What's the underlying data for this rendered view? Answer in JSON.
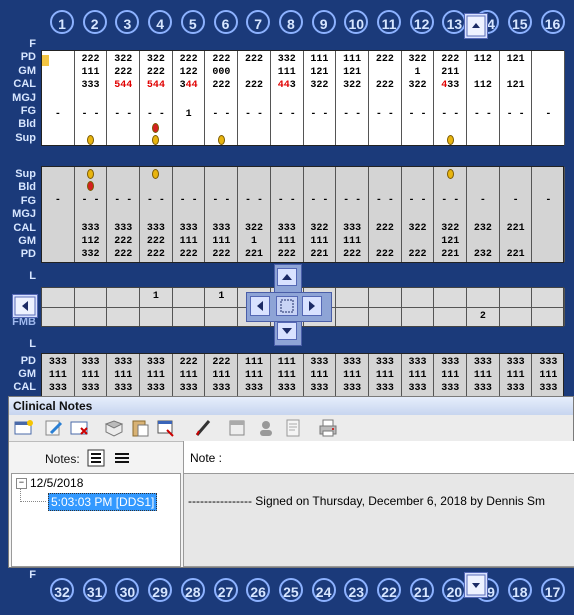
{
  "top_teeth": [
    "1",
    "2",
    "3",
    "4",
    "5",
    "6",
    "7",
    "8",
    "9",
    "10",
    "11",
    "12",
    "13",
    "14",
    "15",
    "16"
  ],
  "bottom_teeth": [
    "32",
    "31",
    "30",
    "29",
    "28",
    "27",
    "26",
    "25",
    "24",
    "23",
    "22",
    "21",
    "20",
    "19",
    "18",
    "17"
  ],
  "upper_facial_labels": [
    "F",
    "PD",
    "GM",
    "CAL",
    "MGJ",
    "FG",
    "Bld",
    "Sup"
  ],
  "upper_lingual_labels": [
    "Sup",
    "Bld",
    "FG",
    "MGJ",
    "CAL",
    "GM",
    "PD"
  ],
  "mid_labels": {
    "l_top": "L",
    "l_bottom": "L",
    "fmb": "FMB"
  },
  "lower_labels": [
    "PD",
    "GM",
    "CAL"
  ],
  "bottom_f_label": "F",
  "upper_facial": {
    "pd": [
      "",
      "222",
      "322",
      "322",
      "222",
      "222",
      "222",
      "332",
      "111",
      "111",
      "222",
      "322",
      "222",
      "112",
      "121",
      ""
    ],
    "gm": [
      "",
      "111",
      "222",
      "222",
      "122",
      "000",
      "",
      "111",
      "121",
      "121",
      "",
      "1",
      "211",
      "",
      "",
      ""
    ],
    "cal": [
      "",
      "333",
      "544",
      "544",
      "344",
      "222",
      "222",
      "443",
      "322",
      "322",
      "222",
      "322",
      "433",
      "112",
      "121",
      ""
    ],
    "fg": [
      "-",
      "- -",
      "- -",
      "- -",
      "1",
      "- -",
      "- -",
      "- -",
      "- -",
      "- -",
      "- -",
      "- -",
      "- -",
      "- -",
      "- -",
      "-"
    ]
  },
  "upper_lingual": {
    "fg": [
      "-",
      "- -",
      "- -",
      "- -",
      "- -",
      "- -",
      "- -",
      "- -",
      "- -",
      "- -",
      "- -",
      "- -",
      "- -",
      "-",
      "-",
      "-"
    ],
    "cal": [
      "",
      "333",
      "333",
      "333",
      "333",
      "333",
      "322",
      "333",
      "322",
      "333",
      "222",
      "322",
      "322",
      "232",
      "221",
      ""
    ],
    "gm": [
      "",
      "112",
      "222",
      "222",
      "111",
      "111",
      "1",
      "111",
      "111",
      "111",
      "",
      "",
      "121",
      "",
      "",
      ""
    ],
    "pd": [
      "",
      "332",
      "222",
      "222",
      "222",
      "222",
      "221",
      "222",
      "221",
      "222",
      "222",
      "222",
      "221",
      "232",
      "221",
      ""
    ]
  },
  "mid_row1": [
    "",
    "",
    "",
    "1",
    "",
    "1",
    "",
    "",
    "",
    "",
    "",
    "",
    "",
    "",
    "",
    ""
  ],
  "mid_row2": [
    "",
    "",
    "",
    "",
    "",
    "",
    "",
    "",
    "",
    "",
    "",
    "",
    "",
    "2",
    "",
    ""
  ],
  "lower_rows": {
    "pd": [
      "333",
      "333",
      "333",
      "333",
      "222",
      "222",
      "111",
      "111",
      "333",
      "333",
      "333",
      "333",
      "333",
      "333",
      "333",
      "333"
    ],
    "gm": [
      "111",
      "111",
      "111",
      "111",
      "111",
      "111",
      "111",
      "111",
      "111",
      "111",
      "111",
      "111",
      "111",
      "111",
      "111",
      "111"
    ],
    "cal": [
      "333",
      "333",
      "333",
      "333",
      "333",
      "333",
      "333",
      "333",
      "333",
      "333",
      "333",
      "333",
      "333",
      "333",
      "333",
      "333"
    ]
  },
  "panel": {
    "title": "Clinical Notes",
    "notes_label": "Notes:",
    "note_label": "Note :",
    "tree_date": "12/5/2018",
    "tree_entry": "5:03:03 PM [DDS1]",
    "note_text": "---------------- Signed on Thursday, December 6, 2018 by Dennis Sm"
  },
  "colors": {
    "background": "#1b3a7a",
    "red_value": "#e00000",
    "selection": "#3399ff"
  }
}
